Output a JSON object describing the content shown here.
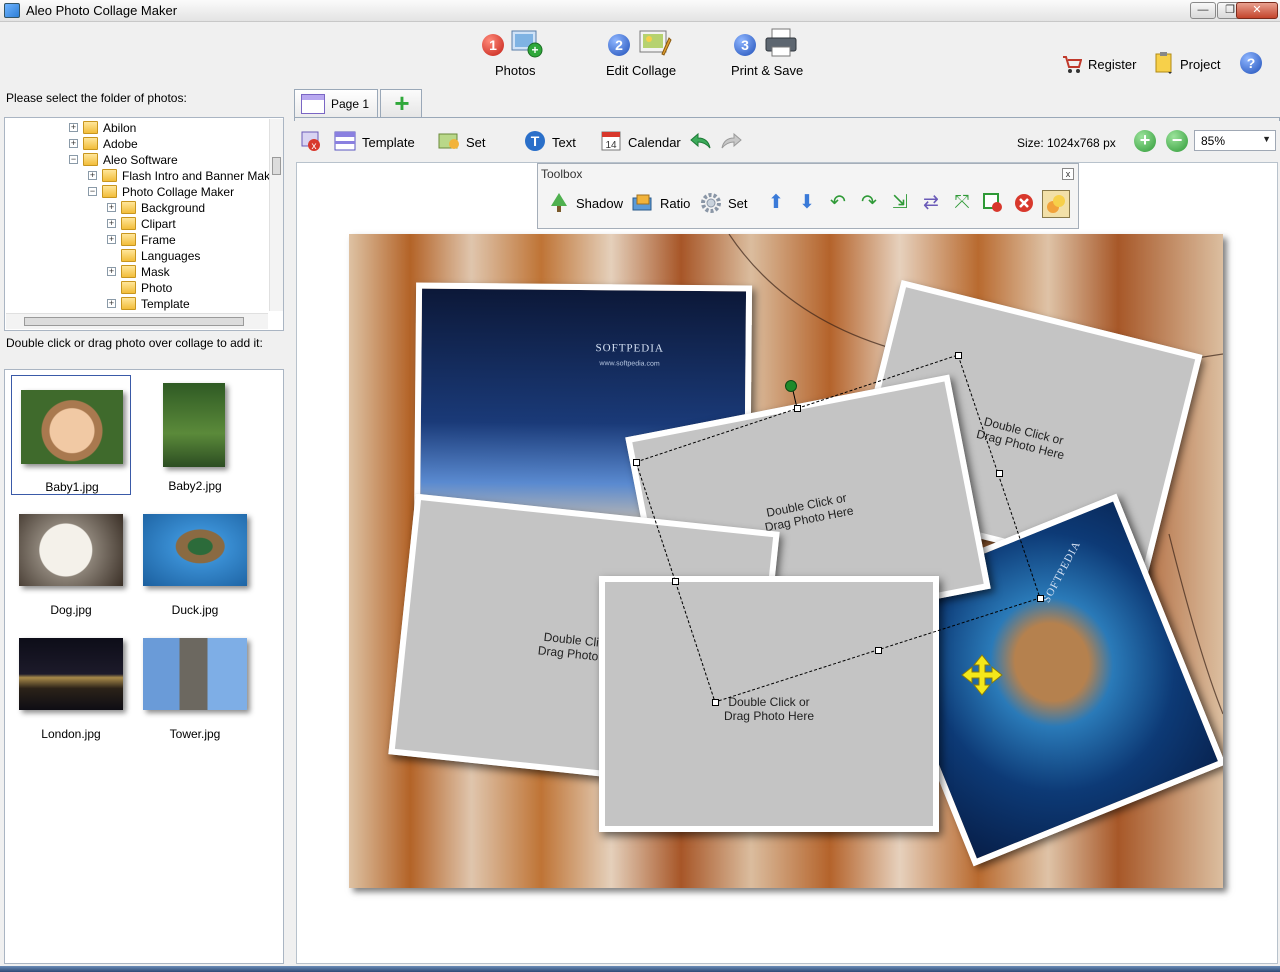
{
  "window": {
    "title": "Aleo Photo Collage Maker",
    "minimize": "—",
    "maximize": "❐",
    "close": "✕"
  },
  "steps": [
    {
      "num": "1",
      "label": "Photos",
      "color": "#d9322a"
    },
    {
      "num": "2",
      "label": "Edit Collage",
      "color": "#2a62c9"
    },
    {
      "num": "3",
      "label": "Print & Save",
      "color": "#2a62c9"
    }
  ],
  "top_right": {
    "register": "Register",
    "project": "Project",
    "help": "?"
  },
  "left": {
    "folder_label": "Please select the folder of photos:",
    "tree": [
      {
        "label": "Abilon",
        "exp": "+"
      },
      {
        "label": "Adobe",
        "exp": "+"
      },
      {
        "label": "Aleo Software",
        "exp": "−"
      },
      {
        "label": "Flash Intro and Banner Maker",
        "exp": "+"
      },
      {
        "label": "Photo Collage Maker",
        "exp": "−"
      },
      {
        "label": "Background",
        "exp": "+"
      },
      {
        "label": "Clipart",
        "exp": "+"
      },
      {
        "label": "Frame",
        "exp": "+"
      },
      {
        "label": "Languages",
        "exp": ""
      },
      {
        "label": "Mask",
        "exp": "+"
      },
      {
        "label": "Photo",
        "exp": ""
      },
      {
        "label": "Template",
        "exp": "+"
      }
    ],
    "drag_hint": "Double click or drag photo over collage to add it:",
    "thumbs": [
      "Baby1.jpg",
      "Baby2.jpg",
      "Dog.jpg",
      "Duck.jpg",
      "London.jpg",
      "Tower.jpg"
    ]
  },
  "tabs": {
    "page1": "Page 1",
    "add": "+"
  },
  "toolbar": {
    "template": "Template",
    "set": "Set",
    "text": "Text",
    "calendar": "Calendar",
    "calendar_day": "14",
    "size": "Size: 1024x768 px",
    "zoom_in": "+",
    "zoom_out": "−",
    "zoom": "85%"
  },
  "toolbox": {
    "title": "Toolbox",
    "close": "x",
    "shadow": "Shadow",
    "ratio": "Ratio",
    "set": "Set"
  },
  "collage": {
    "placeholder_line1": "Double Click or",
    "placeholder_line2": "Drag Photo Here",
    "watermark": "SOFTPEDIA",
    "watermark_url": "www.softpedia.com",
    "watermark_big": "SOFTPEDIA"
  }
}
